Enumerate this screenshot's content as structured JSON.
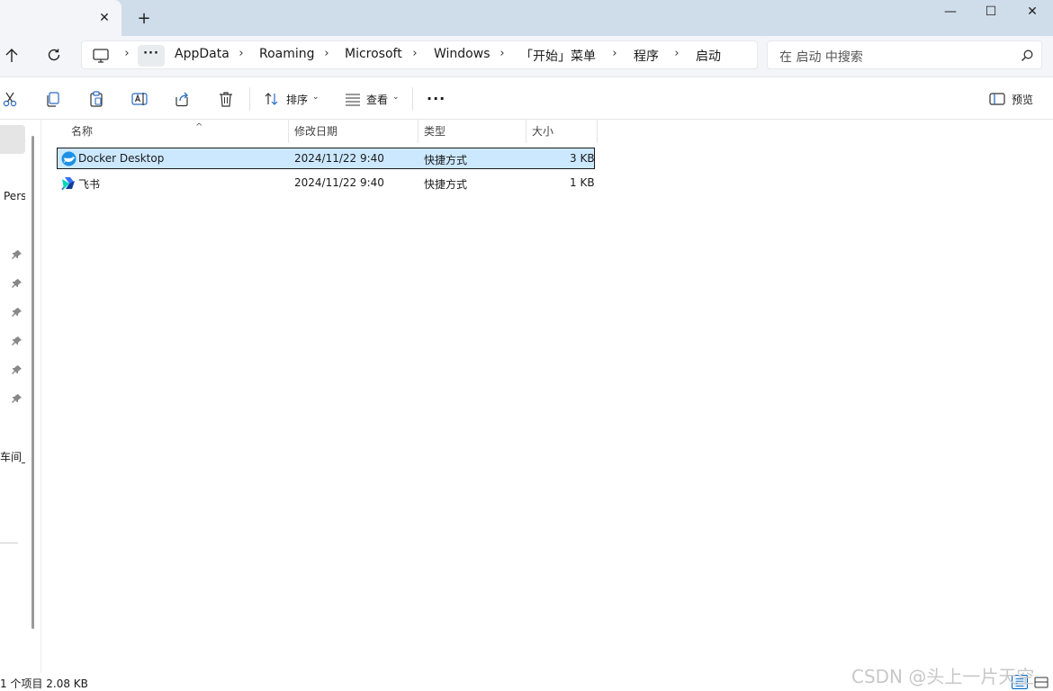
{
  "window": {
    "tab_close_glyph": "✕",
    "new_tab_glyph": "+",
    "min_glyph": "—",
    "max_glyph": "☐",
    "close_glyph": "✕"
  },
  "address": {
    "more_label": "···",
    "crumbs": [
      "AppData",
      "Roaming",
      "Microsoft",
      "Windows",
      "「开始」菜单",
      "程序",
      "启动"
    ],
    "separator": "›"
  },
  "search": {
    "placeholder": "在 启动 中搜索"
  },
  "toolbar": {
    "sort_label": "排序",
    "view_label": "查看",
    "more_label": "···",
    "preview_label": "预览"
  },
  "sidebar": {
    "item_pers": "Pers",
    "item_cut": "车间_s"
  },
  "columns": {
    "name": "名称",
    "modified": "修改日期",
    "type": "类型",
    "size": "大小",
    "sort_indicator": "^"
  },
  "files": [
    {
      "name": "Docker Desktop",
      "modified": "2024/11/22 9:40",
      "type": "快捷方式",
      "size": "3 KB",
      "icon": "docker-icon",
      "selected": true
    },
    {
      "name": "飞书",
      "modified": "2024/11/22 9:40",
      "type": "快捷方式",
      "size": "1 KB",
      "icon": "feishu-icon",
      "selected": false
    }
  ],
  "status": {
    "text": "1 个项目  2.08 KB"
  },
  "watermark": "CSDN @头上一片天空",
  "colors": {
    "selection": "#cce8ff",
    "tabstrip": "#cfdcea",
    "accent": "#0067c0"
  }
}
